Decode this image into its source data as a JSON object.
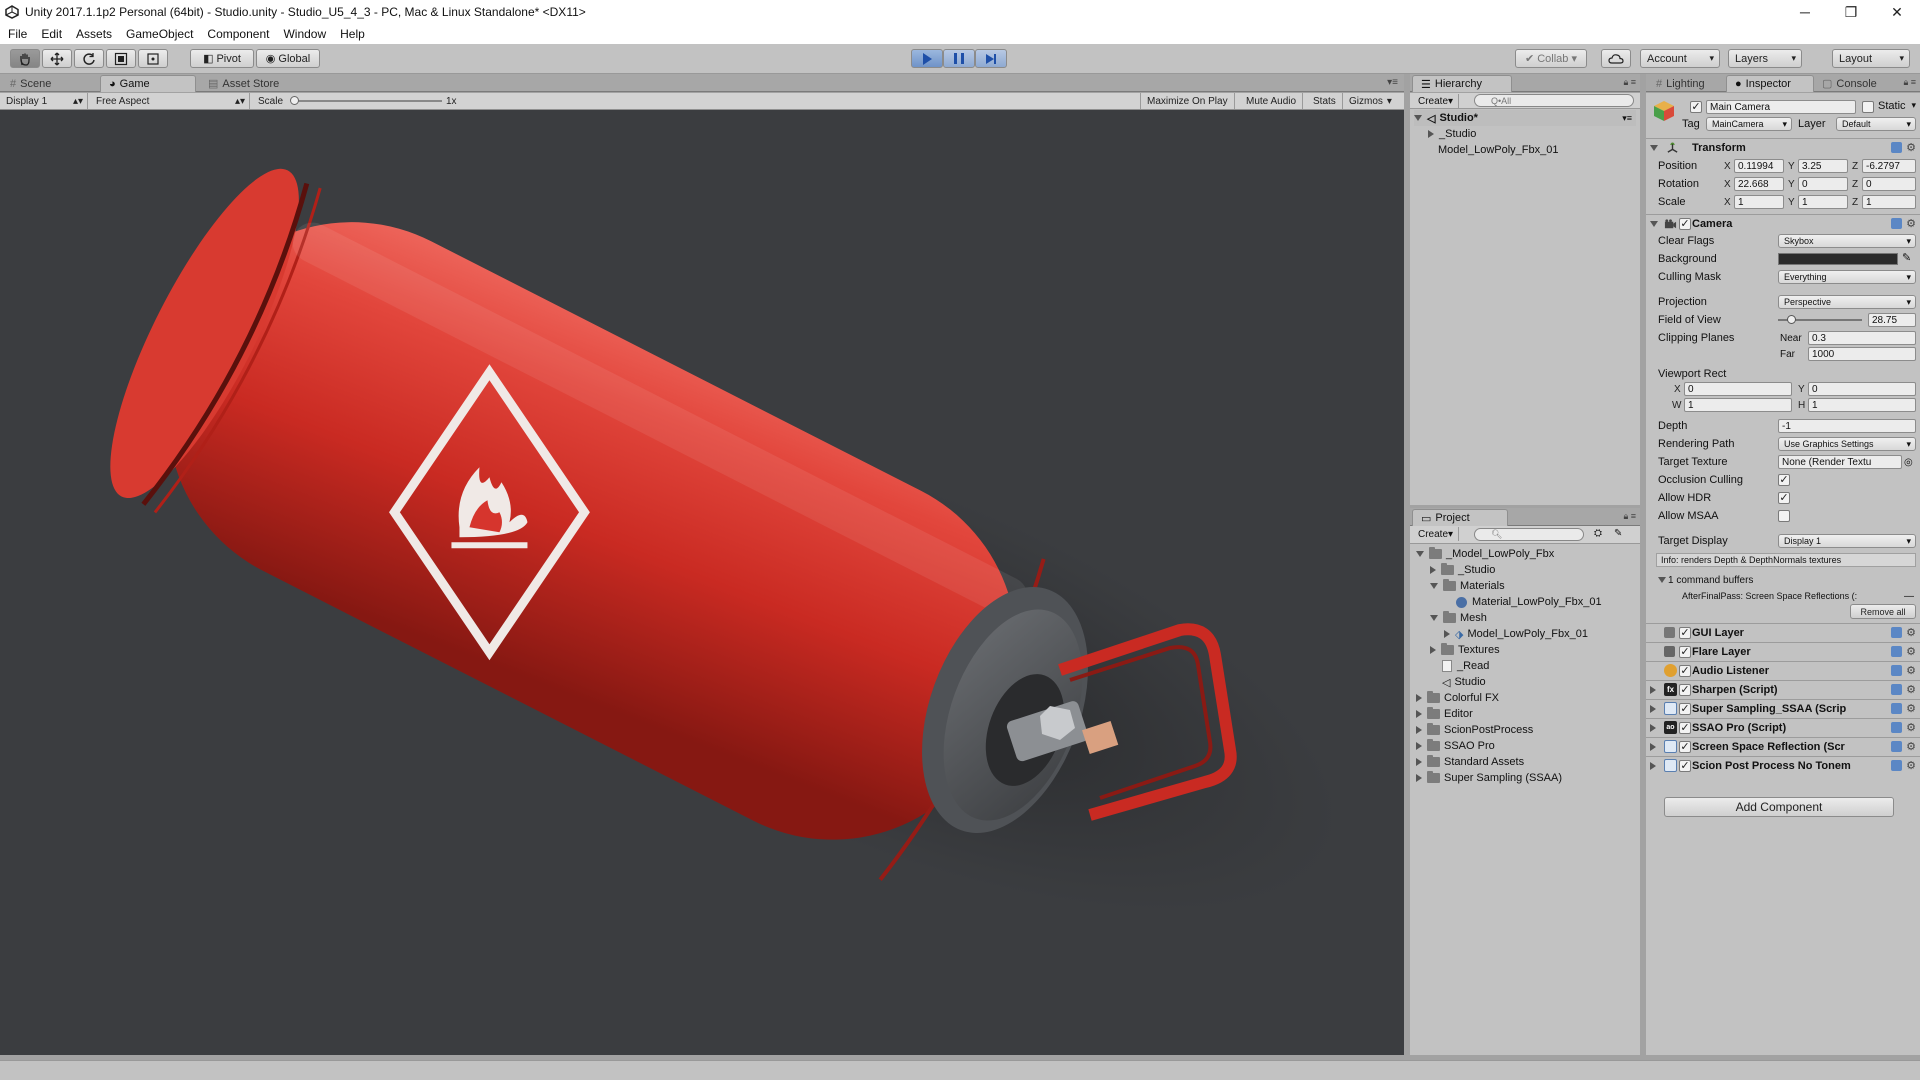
{
  "window": {
    "title": "Unity 2017.1.1p2 Personal (64bit) - Studio.unity - Studio_U5_4_3 - PC, Mac & Linux Standalone* <DX11>",
    "minimize": "─",
    "restore": "❐",
    "close": "✕"
  },
  "menu": [
    "File",
    "Edit",
    "Assets",
    "GameObject",
    "Component",
    "Window",
    "Help"
  ],
  "toolbar": {
    "pivot": "Pivot",
    "global": "Global",
    "collab": "Collab ▾",
    "account": "Account",
    "layers": "Layers",
    "layout": "Layout"
  },
  "scene_tabs": {
    "scene": "Scene",
    "game": "Game",
    "asset_store": "Asset Store"
  },
  "game_controls": {
    "display": "Display 1",
    "aspect": "Free Aspect",
    "scale_label": "Scale",
    "scale_value": "1x",
    "maximize": "Maximize On Play",
    "mute": "Mute Audio",
    "stats": "Stats",
    "gizmos": "Gizmos"
  },
  "hierarchy": {
    "tab": "Hierarchy",
    "create": "Create",
    "search_placeholder": "Q•All",
    "scene": "Studio*",
    "items": [
      "_Studio",
      "Model_LowPoly_Fbx_01"
    ]
  },
  "project": {
    "tab": "Project",
    "create": "Create",
    "tree": [
      "_Model_LowPoly_Fbx",
      "_Studio",
      "Materials",
      "Material_LowPoly_Fbx_01",
      "Mesh",
      "Model_LowPoly_Fbx_01",
      "Textures",
      "_Read",
      "Studio",
      "Colorful FX",
      "Editor",
      "ScionPostProcess",
      "SSAO Pro",
      "Standard Assets",
      "Super Sampling (SSAA)"
    ]
  },
  "inspector": {
    "tabs": {
      "lighting": "Lighting",
      "inspector": "Inspector",
      "console": "Console"
    },
    "object_name": "Main Camera",
    "static": "Static",
    "tag_label": "Tag",
    "tag": "MainCamera",
    "layer_label": "Layer",
    "layer": "Default",
    "transform": {
      "title": "Transform",
      "position_label": "Position",
      "position": [
        "0.11994",
        "3.25",
        "-6.2797"
      ],
      "rotation_label": "Rotation",
      "rotation": [
        "22.668",
        "0",
        "0"
      ],
      "scale_label": "Scale",
      "scale": [
        "1",
        "1",
        "1"
      ]
    },
    "camera": {
      "title": "Camera",
      "clear_flags_label": "Clear Flags",
      "clear_flags": "Skybox",
      "background_label": "Background",
      "culling_mask_label": "Culling Mask",
      "culling_mask": "Everything",
      "projection_label": "Projection",
      "projection": "Perspective",
      "fov_label": "Field of View",
      "fov": "28.75",
      "fov_slider_fraction": 0.16,
      "clipping_label": "Clipping Planes",
      "near_label": "Near",
      "near": "0.3",
      "far_label": "Far",
      "far": "1000",
      "viewport_label": "Viewport Rect",
      "vx": "0",
      "vy": "0",
      "vw": "1",
      "vh": "1",
      "depth_label": "Depth",
      "depth": "-1",
      "rendering_path_label": "Rendering Path",
      "rendering_path": "Use Graphics Settings",
      "target_texture_label": "Target Texture",
      "target_texture": "None (Render Textu",
      "occlusion_label": "Occlusion Culling",
      "hdr_label": "Allow HDR",
      "msaa_label": "Allow MSAA",
      "target_display_label": "Target Display",
      "target_display": "Display 1",
      "info": "Info: renders Depth & DepthNormals textures",
      "buffers": "1 command buffers",
      "afterfinal": "AfterFinalPass: Screen Space Reflections (:",
      "remove_all": "Remove all"
    },
    "components": [
      "GUI Layer",
      "Flare Layer",
      "Audio Listener",
      "Sharpen (Script)",
      "Super Sampling_SSAA (Scrip",
      "SSAO Pro (Script)",
      "Screen Space Reflection (Scr",
      "Scion Post Process No Tonem"
    ],
    "add_component": "Add Component"
  },
  "colors": {
    "play_accent": "#6f93c8",
    "cylinder_red": "#d6352d",
    "viewport_bg": "#3b3d40"
  }
}
